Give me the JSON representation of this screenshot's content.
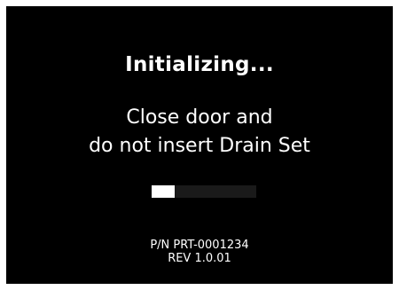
{
  "screen": {
    "title": "Initializing...",
    "message_line1": "Close door and",
    "message_line2": "do not insert Drain Set",
    "progress_fraction": 0.22,
    "part_number": "P/N PRT-0001234",
    "revision": "REV 1.0.01"
  },
  "colors": {
    "background": "#000000",
    "text": "#ffffff",
    "progress_track": "#1a1a1a",
    "progress_fill": "#ffffff"
  }
}
